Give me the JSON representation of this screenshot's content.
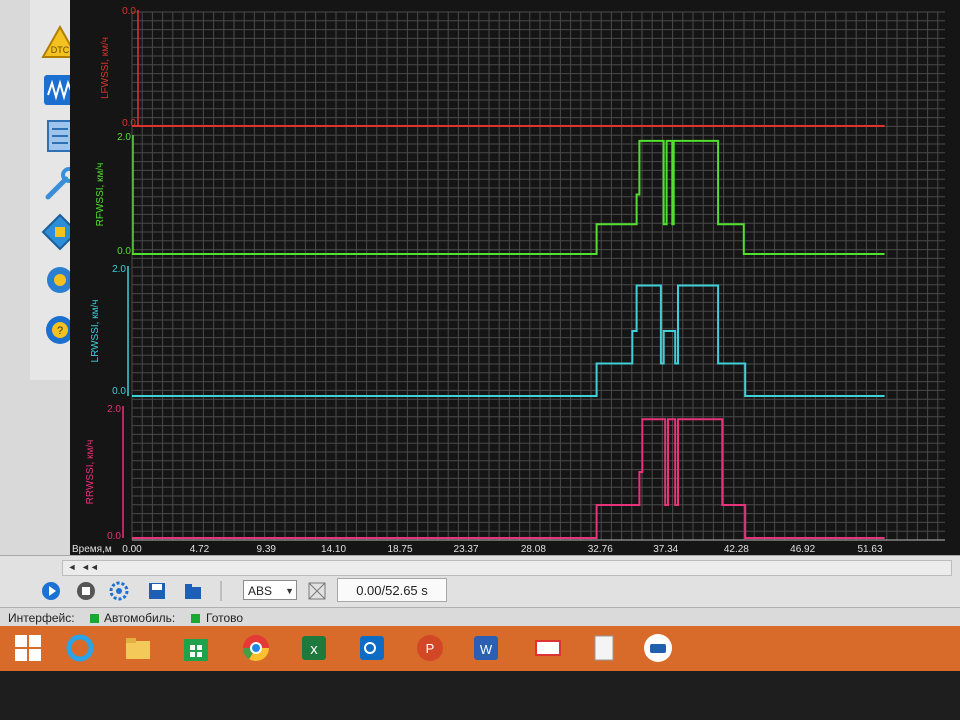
{
  "sidebar": {
    "items": [
      "dtc-icon",
      "oscilloscope-icon",
      "checklist-icon",
      "wrench-icon",
      "chip-icon",
      "settings-gear-icon",
      "help-icon"
    ],
    "dtc_label": "DTC"
  },
  "chart_data": {
    "type": "line",
    "xlabel": "Время,м",
    "x_ticks": [
      "0.00",
      "4.72",
      "9.39",
      "14.10",
      "18.75",
      "23.37",
      "28.08",
      "32.76",
      "37.34",
      "42.28",
      "46.92",
      "51.63"
    ],
    "xlim": [
      0,
      51.63
    ],
    "grid": true,
    "series": [
      {
        "name": "LFWSSI, км/ч",
        "color": "#e0332e",
        "ylim": [
          0.0,
          0.0
        ],
        "y_ticks": [
          "0.0",
          "0.0"
        ],
        "points": [
          [
            0,
            0
          ],
          [
            52.65,
            0
          ]
        ]
      },
      {
        "name": "RFWSSI, км/ч",
        "color": "#52e02e",
        "ylim": [
          0.0,
          2.0
        ],
        "y_ticks": [
          "2.0",
          "0.0"
        ],
        "points": [
          [
            0,
            0
          ],
          [
            32.5,
            0
          ],
          [
            32.5,
            0.5
          ],
          [
            35.3,
            0.5
          ],
          [
            35.3,
            1.0
          ],
          [
            35.5,
            1.0
          ],
          [
            35.5,
            1.9
          ],
          [
            37.2,
            1.9
          ],
          [
            37.2,
            0.5
          ],
          [
            37.4,
            0.5
          ],
          [
            37.4,
            1.9
          ],
          [
            37.8,
            1.9
          ],
          [
            37.8,
            0.5
          ],
          [
            37.9,
            0.5
          ],
          [
            37.9,
            1.9
          ],
          [
            41.0,
            1.9
          ],
          [
            41.0,
            0.5
          ],
          [
            42.8,
            0.5
          ],
          [
            42.8,
            0
          ],
          [
            52.65,
            0
          ]
        ]
      },
      {
        "name": "LRWSSI, км/ч",
        "color": "#3fd0d8",
        "ylim": [
          0.0,
          2.0
        ],
        "y_ticks": [
          "2.0",
          "0.0"
        ],
        "points": [
          [
            0,
            0
          ],
          [
            32.5,
            0
          ],
          [
            32.5,
            0.5
          ],
          [
            35.0,
            0.5
          ],
          [
            35.0,
            1.0
          ],
          [
            35.3,
            1.0
          ],
          [
            35.3,
            1.7
          ],
          [
            37.0,
            1.7
          ],
          [
            37.0,
            0.5
          ],
          [
            37.2,
            0.5
          ],
          [
            37.2,
            1.0
          ],
          [
            38.0,
            1.0
          ],
          [
            38.0,
            0.5
          ],
          [
            38.2,
            0.5
          ],
          [
            38.2,
            1.7
          ],
          [
            41.0,
            1.7
          ],
          [
            41.0,
            0.5
          ],
          [
            42.9,
            0.5
          ],
          [
            42.9,
            0
          ],
          [
            52.65,
            0
          ]
        ]
      },
      {
        "name": "RRWSSI, км/ч",
        "color": "#e8327a",
        "ylim": [
          0.0,
          2.0
        ],
        "y_ticks": [
          "2.0",
          "0.0"
        ],
        "points": [
          [
            0,
            0
          ],
          [
            32.5,
            0
          ],
          [
            32.5,
            0.5
          ],
          [
            35.5,
            0.5
          ],
          [
            35.5,
            1.0
          ],
          [
            35.7,
            1.0
          ],
          [
            35.7,
            1.8
          ],
          [
            37.3,
            1.8
          ],
          [
            37.3,
            0.5
          ],
          [
            37.5,
            0.5
          ],
          [
            37.5,
            1.8
          ],
          [
            38.0,
            1.8
          ],
          [
            38.0,
            0.5
          ],
          [
            38.2,
            0.5
          ],
          [
            38.2,
            1.8
          ],
          [
            41.3,
            1.8
          ],
          [
            41.3,
            0.5
          ],
          [
            42.9,
            0.5
          ],
          [
            42.9,
            0
          ],
          [
            52.65,
            0
          ]
        ]
      }
    ]
  },
  "toolbar": {
    "mode_select": "ABS",
    "time_readout": "0.00/52.65 s"
  },
  "status": {
    "interface_label": "Интерфейс:",
    "car_label": "Автомобиль:",
    "ready_label": "Готово"
  },
  "taskbar": {
    "items": [
      "windows-start-icon",
      "internet-explorer-icon",
      "file-explorer-icon",
      "store-icon",
      "chrome-icon",
      "excel-icon",
      "outlook-icon",
      "powerpoint-icon",
      "word-icon",
      "app-window-icon",
      "notepad-icon",
      "diagnostic-app-icon"
    ]
  }
}
